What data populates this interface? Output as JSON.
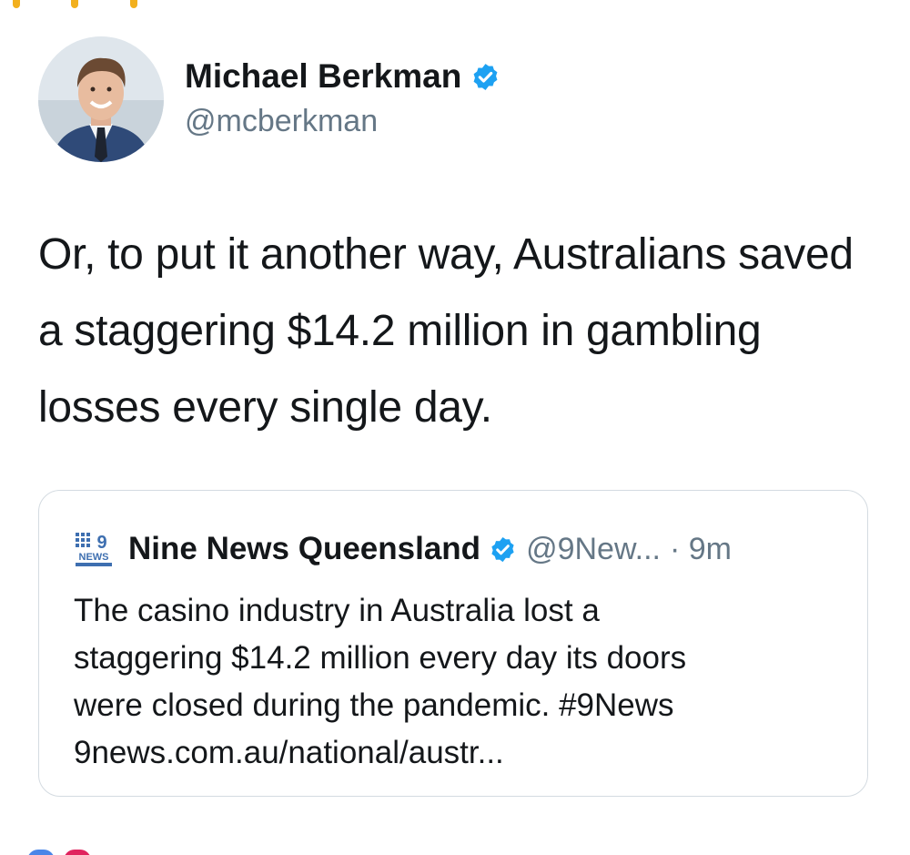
{
  "author": {
    "display_name": "Michael Berkman",
    "handle": "@mcberkman",
    "verified": true
  },
  "tweet": {
    "text": "Or, to put it another way, Australians saved a staggering $14.2 million in gambling losses every single day."
  },
  "quoted_tweet": {
    "display_name": "Nine News Queensland",
    "handle": "@9New...",
    "time": "· 9m",
    "verified": true,
    "text_lines": [
      "The casino industry in Australia lost a",
      "staggering $14.2 million every day its doors",
      "were closed during the pandemic. #9News",
      "9news.com.au/national/austr..."
    ]
  },
  "colors": {
    "text_primary": "#14171a",
    "text_secondary": "#657786",
    "verified_blue": "#1da1f2",
    "card_border": "#d4dbe1"
  },
  "icons": {
    "verified": "verified-badge-icon",
    "quoted_avatar": "nine-news-logo-icon"
  }
}
